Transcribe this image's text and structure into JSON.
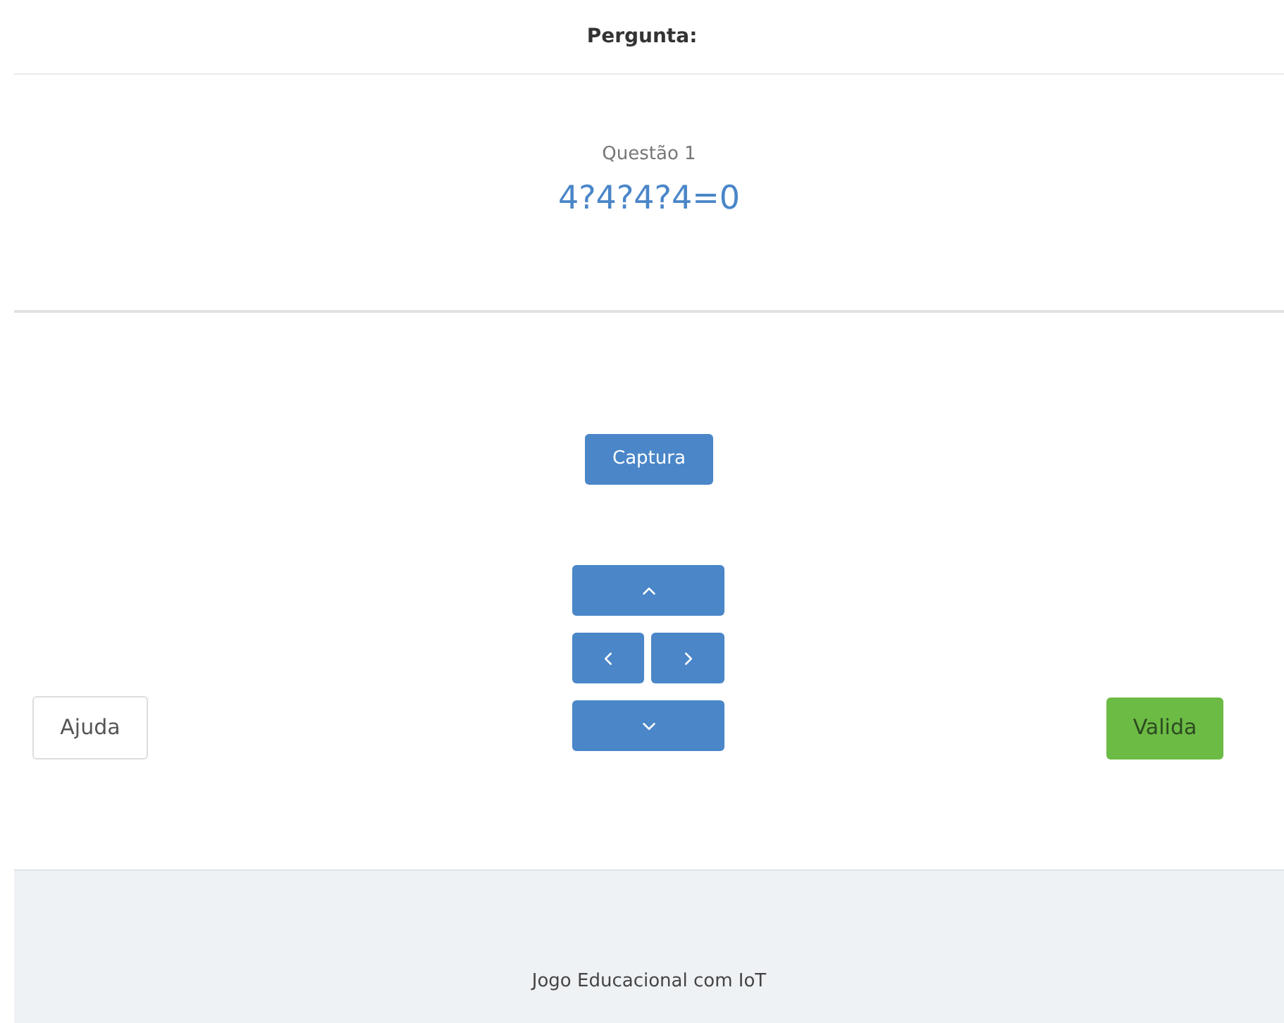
{
  "header": {
    "title": "Pergunta:"
  },
  "question": {
    "label": "Questão 1",
    "expression": "4?4?4?4=0"
  },
  "capture_button": {
    "label": "Captura"
  },
  "help_button": {
    "label": "Ajuda"
  },
  "validate_button": {
    "label": "Valida"
  },
  "footer": {
    "text": "Jogo Educacional com IoT"
  }
}
